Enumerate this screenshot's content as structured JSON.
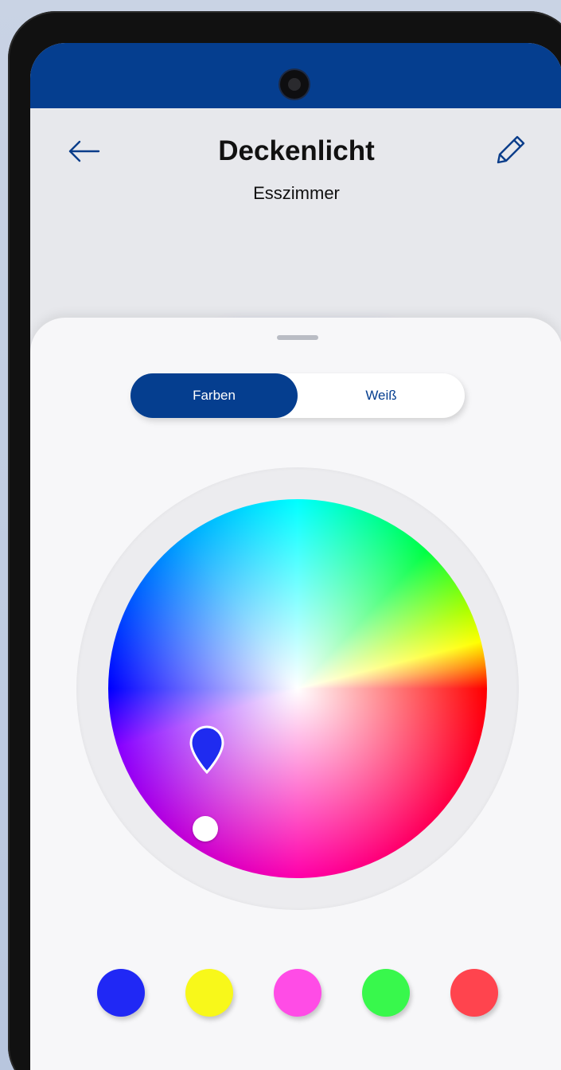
{
  "header": {
    "title": "Deckenlicht",
    "subtitle": "Esszimmer"
  },
  "tabs": {
    "colors_label": "Farben",
    "white_label": "Weiß",
    "active": "colors"
  },
  "color_picker": {
    "selected_color": "#1f2bf0"
  },
  "presets": [
    {
      "name": "blue",
      "color": "#2028f5"
    },
    {
      "name": "yellow",
      "color": "#f8f81a"
    },
    {
      "name": "magenta",
      "color": "#ff4ce6"
    },
    {
      "name": "green",
      "color": "#38f84c"
    },
    {
      "name": "red",
      "color": "#ff444e"
    }
  ],
  "icons": {
    "back": "arrow-left-icon",
    "edit": "pencil-icon"
  },
  "colors": {
    "brand": "#053e8f",
    "background": "#e7e8ec",
    "sheet": "#f7f7f9"
  }
}
